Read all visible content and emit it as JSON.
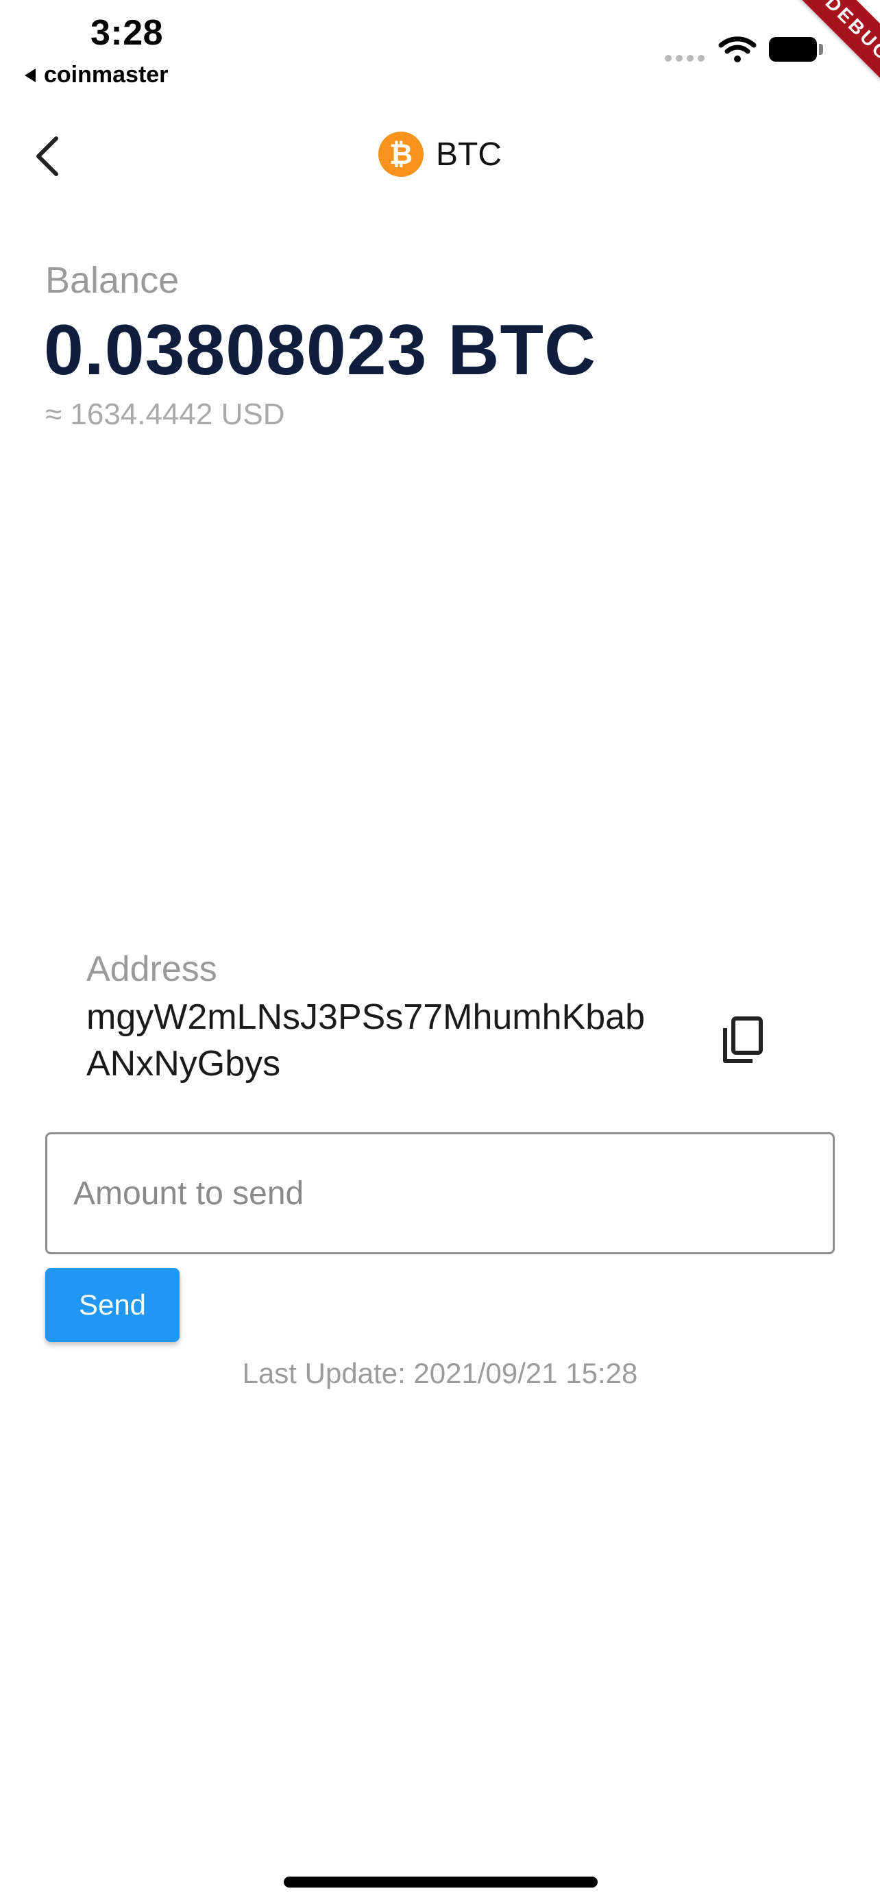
{
  "status_bar": {
    "time": "3:28",
    "back_app": "coinmaster",
    "debug_banner": "DEBUG"
  },
  "app_bar": {
    "coin_symbol_glyph": "₿",
    "title": "BTC"
  },
  "balance": {
    "label": "Balance",
    "value": "0.03808023 BTC",
    "fiat": "≈ 1634.4442 USD"
  },
  "address": {
    "label": "Address",
    "line1": "mgyW2mLNsJ3PSs77MhumhKbab",
    "line2": "ANxNyGbys"
  },
  "send_form": {
    "amount_placeholder": "Amount to send",
    "amount_value": "",
    "send_label": "Send"
  },
  "footer": {
    "last_update": "Last Update: 2021/09/21 15:28"
  },
  "colors": {
    "accent": "#2196f3",
    "btc_orange": "#f7931a",
    "balance_text": "#0f1e3d",
    "debug_red": "#a8141e"
  },
  "icons": {
    "back": "chevron-left-icon",
    "copy": "copy-icon",
    "wifi": "wifi-icon",
    "battery": "battery-icon",
    "coin": "bitcoin-logo-icon"
  }
}
